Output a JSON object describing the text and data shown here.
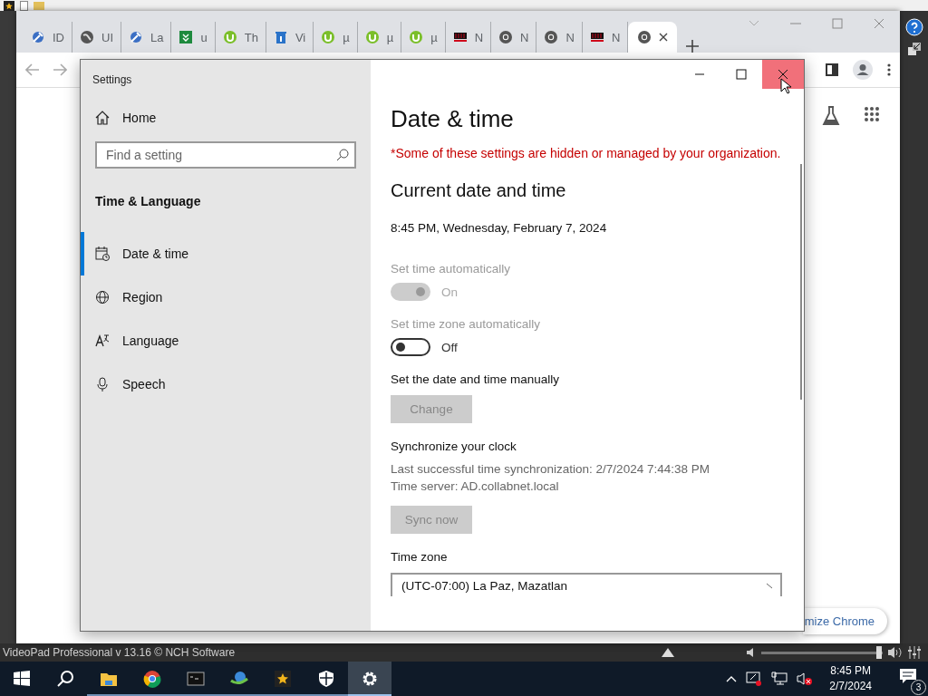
{
  "videopad": {
    "status_text": "VideoPad Professional v 13.16 © NCH Software",
    "volume": {
      "level": 0.97
    }
  },
  "browser": {
    "tabs": [
      {
        "label": "ID",
        "kind": "wrench",
        "selected": false
      },
      {
        "label": "UI",
        "kind": "globe",
        "selected": false
      },
      {
        "label": "La",
        "kind": "wrench",
        "selected": false
      },
      {
        "label": "u",
        "kind": "download",
        "selected": false
      },
      {
        "label": "Th",
        "kind": "torrent",
        "selected": false
      },
      {
        "label": "Vi",
        "kind": "bin",
        "selected": false
      },
      {
        "label": "µ",
        "kind": "torrent",
        "selected": false
      },
      {
        "label": "µ",
        "kind": "torrent",
        "selected": false
      },
      {
        "label": "µ",
        "kind": "torrent",
        "selected": false
      },
      {
        "label": "N",
        "kind": "nch",
        "selected": false
      },
      {
        "label": "N",
        "kind": "chrome",
        "selected": false
      },
      {
        "label": "N",
        "kind": "chrome",
        "selected": false
      },
      {
        "label": "N",
        "kind": "nch",
        "selected": false
      },
      {
        "kind": "chrome",
        "selected": true
      }
    ],
    "customize_button": "mize Chrome"
  },
  "settings": {
    "title": "Settings",
    "home": "Home",
    "search": {
      "placeholder": "Find a setting"
    },
    "section": "Time & Language",
    "nav": [
      {
        "label": "Date & time",
        "kind": "calendar",
        "selected": true
      },
      {
        "label": "Region",
        "kind": "globe",
        "selected": false
      },
      {
        "label": "Language",
        "kind": "language",
        "selected": false
      },
      {
        "label": "Speech",
        "kind": "mic",
        "selected": false
      }
    ],
    "page_title": "Date & time",
    "notice": "*Some of these settings are hidden or managed by your organization.",
    "heading": "Current date and time",
    "current": "8:45 PM, Wednesday, February 7, 2024",
    "rows": [
      {
        "kind": "toggle",
        "label": "Set time automatically",
        "on": true,
        "disabled": true,
        "state_text": "On"
      },
      {
        "kind": "toggle",
        "label": "Set time zone automatically",
        "on": false,
        "disabled": false,
        "state_text": "Off"
      },
      {
        "kind": "button",
        "label": "Set the date and time manually",
        "button": "Change",
        "disabled": true
      },
      {
        "kind": "sync",
        "label": "Synchronize your clock",
        "lines": [
          "Last successful time synchronization: 2/7/2024 7:44:38 PM",
          "Time server: AD.collabnet.local"
        ],
        "button": "Sync now",
        "disabled": true
      },
      {
        "kind": "select",
        "label": "Time zone",
        "value": "(UTC-07:00) La Paz, Mazatlan"
      }
    ]
  },
  "taskbar": {
    "apps": [
      {
        "kind": "start",
        "running": false,
        "selected": false
      },
      {
        "kind": "search",
        "running": false,
        "selected": false
      },
      {
        "kind": "explorer",
        "running": true,
        "selected": false
      },
      {
        "kind": "chrome",
        "running": true,
        "selected": false
      },
      {
        "kind": "terminal",
        "running": true,
        "selected": false
      },
      {
        "kind": "downloader",
        "running": true,
        "selected": false
      },
      {
        "kind": "videopad",
        "running": true,
        "selected": false
      },
      {
        "kind": "shield",
        "running": true,
        "selected": false
      },
      {
        "kind": "settings",
        "running": true,
        "selected": true
      }
    ],
    "time": "8:45 PM",
    "date": "2/7/2024",
    "notifications": "3"
  }
}
